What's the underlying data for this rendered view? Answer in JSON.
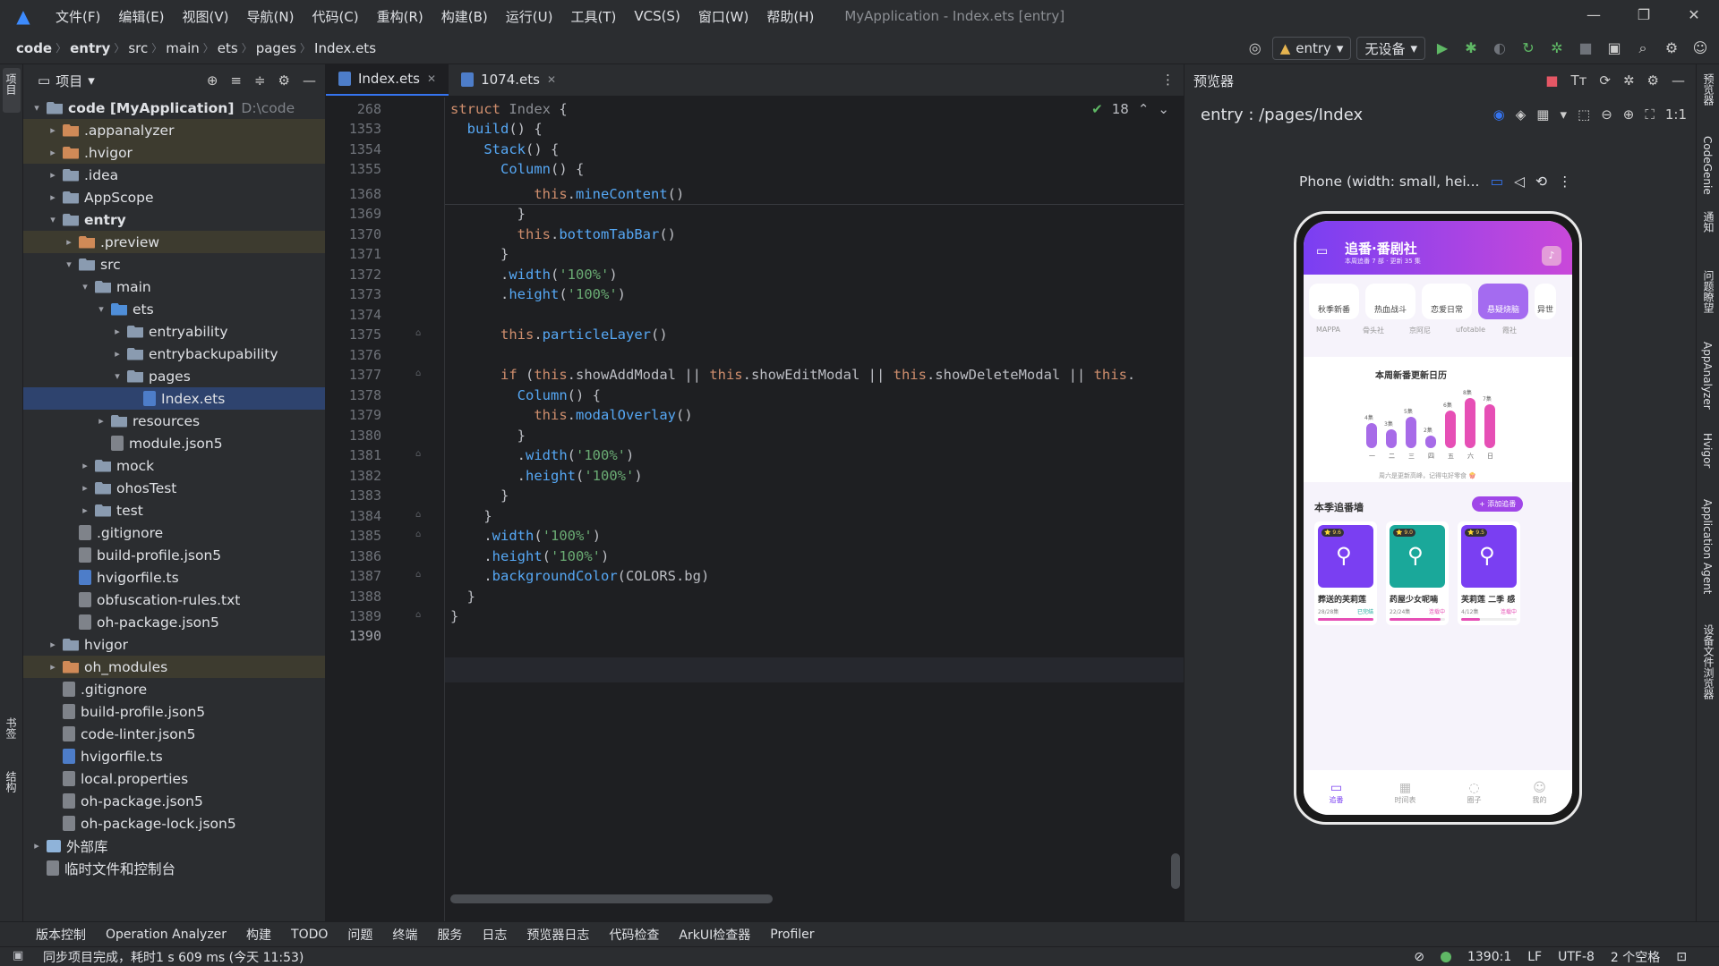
{
  "menubar": {
    "items": [
      "文件(F)",
      "编辑(E)",
      "视图(V)",
      "导航(N)",
      "代码(C)",
      "重构(R)",
      "构建(B)",
      "运行(U)",
      "工具(T)",
      "VCS(S)",
      "窗口(W)",
      "帮助(H)"
    ],
    "window_title": "MyApplication - Index.ets [entry]"
  },
  "breadcrumb": [
    "code",
    "entry",
    "src",
    "main",
    "ets",
    "pages",
    "Index.ets"
  ],
  "run": {
    "module": "entry",
    "device": "无设备"
  },
  "left_strip": {
    "project": "项目",
    "bookmarks": "书签",
    "structure": "结构"
  },
  "project": {
    "title": "项目",
    "tree": [
      {
        "label": "code [MyApplication]",
        "hint": "D:\\code",
        "depth": 0,
        "arrow": "▾",
        "icon": "folder",
        "bold": true
      },
      {
        "label": ".appanalyzer",
        "depth": 1,
        "arrow": "▸",
        "icon": "ofolder",
        "hl": true
      },
      {
        "label": ".hvigor",
        "depth": 1,
        "arrow": "▸",
        "icon": "ofolder",
        "hl": true
      },
      {
        "label": ".idea",
        "depth": 1,
        "arrow": "▸",
        "icon": "folder"
      },
      {
        "label": "AppScope",
        "depth": 1,
        "arrow": "▸",
        "icon": "folder"
      },
      {
        "label": "entry",
        "depth": 1,
        "arrow": "▾",
        "icon": "folder",
        "bold": true
      },
      {
        "label": ".preview",
        "depth": 2,
        "arrow": "▸",
        "icon": "ofolder",
        "hl": true
      },
      {
        "label": "src",
        "depth": 2,
        "arrow": "▾",
        "icon": "folder"
      },
      {
        "label": "main",
        "depth": 3,
        "arrow": "▾",
        "icon": "folder"
      },
      {
        "label": "ets",
        "depth": 4,
        "arrow": "▾",
        "icon": "bfolder"
      },
      {
        "label": "entryability",
        "depth": 5,
        "arrow": "▸",
        "icon": "folder"
      },
      {
        "label": "entrybackupability",
        "depth": 5,
        "arrow": "▸",
        "icon": "folder"
      },
      {
        "label": "pages",
        "depth": 5,
        "arrow": "▾",
        "icon": "folder"
      },
      {
        "label": "Index.ets",
        "depth": 6,
        "arrow": "",
        "icon": "ts",
        "sel": true
      },
      {
        "label": "resources",
        "depth": 4,
        "arrow": "▸",
        "icon": "folder"
      },
      {
        "label": "module.json5",
        "depth": 4,
        "arrow": "",
        "icon": "file"
      },
      {
        "label": "mock",
        "depth": 3,
        "arrow": "▸",
        "icon": "folder"
      },
      {
        "label": "ohosTest",
        "depth": 3,
        "arrow": "▸",
        "icon": "folder"
      },
      {
        "label": "test",
        "depth": 3,
        "arrow": "▸",
        "icon": "folder"
      },
      {
        "label": ".gitignore",
        "depth": 2,
        "arrow": "",
        "icon": "file"
      },
      {
        "label": "build-profile.json5",
        "depth": 2,
        "arrow": "",
        "icon": "file"
      },
      {
        "label": "hvigorfile.ts",
        "depth": 2,
        "arrow": "",
        "icon": "ts"
      },
      {
        "label": "obfuscation-rules.txt",
        "depth": 2,
        "arrow": "",
        "icon": "file"
      },
      {
        "label": "oh-package.json5",
        "depth": 2,
        "arrow": "",
        "icon": "file"
      },
      {
        "label": "hvigor",
        "depth": 1,
        "arrow": "▸",
        "icon": "folder"
      },
      {
        "label": "oh_modules",
        "depth": 1,
        "arrow": "▸",
        "icon": "ofolder",
        "hl": true
      },
      {
        "label": ".gitignore",
        "depth": 1,
        "arrow": "",
        "icon": "file"
      },
      {
        "label": "build-profile.json5",
        "depth": 1,
        "arrow": "",
        "icon": "file"
      },
      {
        "label": "code-linter.json5",
        "depth": 1,
        "arrow": "",
        "icon": "file"
      },
      {
        "label": "hvigorfile.ts",
        "depth": 1,
        "arrow": "",
        "icon": "ts"
      },
      {
        "label": "local.properties",
        "depth": 1,
        "arrow": "",
        "icon": "file"
      },
      {
        "label": "oh-package.json5",
        "depth": 1,
        "arrow": "",
        "icon": "file"
      },
      {
        "label": "oh-package-lock.json5",
        "depth": 1,
        "arrow": "",
        "icon": "file"
      },
      {
        "label": "外部库",
        "depth": 0,
        "arrow": "▸",
        "icon": "lib"
      },
      {
        "label": "临时文件和控制台",
        "depth": 0,
        "arrow": "",
        "icon": "file"
      }
    ]
  },
  "editor": {
    "tabs": [
      {
        "label": "Index.ets",
        "active": true
      },
      {
        "label": "1074.ets",
        "active": false
      }
    ],
    "inspections": "18",
    "current_line": "1390",
    "lines": [
      {
        "n": "268",
        "html": "<span class='kw'>struct</span> <span class='dim'>Index</span> {"
      },
      {
        "n": "1353",
        "html": "  <span class='fn'>build</span>() {"
      },
      {
        "n": "1354",
        "html": "    <span class='fn'>Stack</span>() {"
      },
      {
        "n": "1355",
        "html": "      <span class='fn'>Column</span>() {"
      },
      {
        "n": "1368",
        "html": "          <span class='th'>this</span>.<span class='me'>mineContent</span>()"
      },
      {
        "n": "1369",
        "html": "        }"
      },
      {
        "n": "1370",
        "html": "        <span class='th'>this</span>.<span class='me'>bottomTabBar</span>()"
      },
      {
        "n": "1371",
        "html": "      }"
      },
      {
        "n": "1372",
        "html": "      .<span class='me'>width</span>(<span class='str'>'100%'</span>)"
      },
      {
        "n": "1373",
        "html": "      .<span class='me'>height</span>(<span class='str'>'100%'</span>)"
      },
      {
        "n": "1374",
        "html": ""
      },
      {
        "n": "1375",
        "html": "      <span class='th'>this</span>.<span class='me'>particleLayer</span>()"
      },
      {
        "n": "1376",
        "html": ""
      },
      {
        "n": "1377",
        "html": "      <span class='kw'>if</span> (<span class='th'>this</span>.showAddModal || <span class='th'>this</span>.showEditModal || <span class='th'>this</span>.showDeleteModal || <span class='th'>this</span>."
      },
      {
        "n": "1378",
        "html": "        <span class='fn'>Column</span>() {"
      },
      {
        "n": "1379",
        "html": "          <span class='th'>this</span>.<span class='me'>modalOverlay</span>()"
      },
      {
        "n": "1380",
        "html": "        }"
      },
      {
        "n": "1381",
        "html": "        .<span class='me'>width</span>(<span class='str'>'100%'</span>)"
      },
      {
        "n": "1382",
        "html": "        .<span class='me'>height</span>(<span class='str'>'100%'</span>)"
      },
      {
        "n": "1383",
        "html": "      }"
      },
      {
        "n": "1384",
        "html": "    }"
      },
      {
        "n": "1385",
        "html": "    .<span class='me'>width</span>(<span class='str'>'100%'</span>)"
      },
      {
        "n": "1386",
        "html": "    .<span class='me'>height</span>(<span class='str'>'100%'</span>)"
      },
      {
        "n": "1387",
        "html": "    .<span class='me'>backgroundColor</span>(COLORS.bg)"
      },
      {
        "n": "1388",
        "html": "  }"
      },
      {
        "n": "1389",
        "html": "}"
      },
      {
        "n": "1390",
        "html": ""
      }
    ]
  },
  "preview": {
    "title": "预览器",
    "route": "entry : /pages/Index",
    "device": "Phone (width: small, hei...",
    "app": {
      "title": "追番·番剧社",
      "subtitle": "本周追番 7 部 · 更新 35 集",
      "chips": [
        "秋季新番",
        "热血战斗",
        "恋爱日常",
        "悬疑烧脑",
        "异世"
      ],
      "tags": [
        "MAPPA",
        "骨头社",
        "京阿尼",
        "ufotable",
        "霞社"
      ],
      "calendar_title": "本周新番更新日历",
      "days": [
        "一",
        "二",
        "三",
        "四",
        "五",
        "六",
        "日"
      ],
      "day_counts": [
        4,
        3,
        5,
        2,
        6,
        8,
        7
      ],
      "day_labels": [
        "4集",
        "3集",
        "5集",
        "2集",
        "6集",
        "8集",
        "7集"
      ],
      "calendar_note": "周六是更新高峰，记得屯好零食 🍿",
      "wall_title": "本季追番墙",
      "add_button": "+ 添加追番",
      "shows": [
        {
          "name": "葬送的芙莉莲",
          "rating": "⭐ 9.6",
          "progress": "28/28集",
          "status": "已完结"
        },
        {
          "name": "药屋少女呢喃",
          "rating": "⭐ 9.0",
          "progress": "22/24集",
          "status": "连载中"
        },
        {
          "name": "芙莉莲 二季 感",
          "rating": "⭐ 9.5",
          "progress": "4/12集",
          "status": "连载中"
        }
      ],
      "tabbar": [
        "追番",
        "时间表",
        "圈子",
        "我的"
      ]
    }
  },
  "right_strip": [
    "预览器",
    "CodeGenie",
    "通知",
    "问题瞭望",
    "AppAnalyzer",
    "Hvigor",
    "Application Agent",
    "设备文件浏览器"
  ],
  "toolwindows": [
    "版本控制",
    "Operation Analyzer",
    "构建",
    "TODO",
    "问题",
    "终端",
    "服务",
    "日志",
    "预览器日志",
    "代码检查",
    "ArkUI检查器",
    "Profiler"
  ],
  "status": {
    "message": "同步项目完成，耗时1 s 609 ms (今天 11:53)",
    "position": "1390:1",
    "line_sep": "LF",
    "encoding": "UTF-8",
    "indent": "2 个空格"
  },
  "colors": {
    "accent": "#3574f0",
    "app_purple": "#7a3ff2",
    "app_pink": "#e64fb5"
  }
}
